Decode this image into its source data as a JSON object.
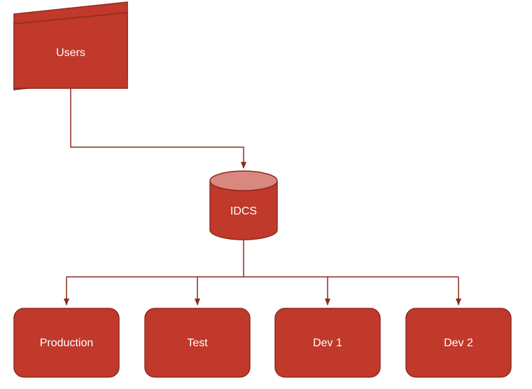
{
  "diagram": {
    "color_fill": "#c0392b",
    "color_stroke": "#8e2a1f",
    "cylinder_top_fill": "#d98880",
    "users": {
      "label": "Users"
    },
    "idcs": {
      "label": "IDCS"
    },
    "targets": [
      {
        "label": "Production"
      },
      {
        "label": "Test"
      },
      {
        "label": "Dev 1"
      },
      {
        "label": "Dev 2"
      }
    ]
  }
}
